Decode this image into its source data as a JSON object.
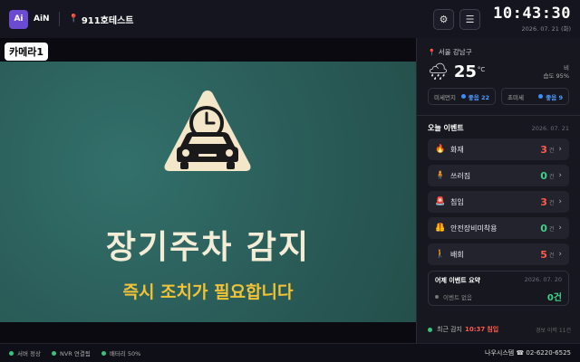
{
  "header": {
    "logo_text": "Ai",
    "brand": "AiN",
    "site": "911호테스트",
    "settings_icon": "gear-icon",
    "menu_icon": "menu-icon",
    "time": "10:43:30",
    "date": "2026. 07. 21 (화)"
  },
  "camera": {
    "label": "카메라1",
    "alert_title": "장기주차 감지",
    "alert_subtitle": "즉시 조치가 필요합니다",
    "colors": {
      "background": "#2c5f5b",
      "title": "#f3ecd6",
      "subtitle": "#f2c335",
      "sign": "#f3e6c9"
    }
  },
  "weather": {
    "location": "서울 강남구",
    "icon": "rain-cloud-icon",
    "temperature": "25",
    "unit": "°C",
    "condition": "비",
    "humidity": "습도 95%",
    "fine_dust_label": "미세먼지",
    "fine_dust_value": "좋음 22",
    "ultrafine_label": "초미세",
    "ultrafine_value": "좋음 9"
  },
  "events": {
    "title": "오늘 이벤트",
    "date": "2026. 07. 21",
    "unit": "건",
    "items": [
      {
        "name": "화재",
        "icon": "fire-icon",
        "glyph": "🔥",
        "count": "3",
        "color": "#ff5a4a"
      },
      {
        "name": "쓰러짐",
        "icon": "fall-person-icon",
        "glyph": "🧍",
        "count": "0",
        "color": "#3ed28a"
      },
      {
        "name": "침입",
        "icon": "alarm-icon",
        "glyph": "🚨",
        "count": "3",
        "color": "#ff5a4a"
      },
      {
        "name": "안전장비미착용",
        "icon": "safety-vest-icon",
        "glyph": "🦺",
        "count": "0",
        "color": "#3ed28a"
      },
      {
        "name": "배회",
        "icon": "walking-person-icon",
        "glyph": "🚶",
        "count": "5",
        "color": "#ff5a4a"
      }
    ]
  },
  "summary": {
    "title": "어제 이벤트 요약",
    "date": "2026. 07. 20",
    "text": "이벤트 없음",
    "value": "0건"
  },
  "recent": {
    "label": "최근 감지",
    "time": "10:37",
    "type": "침입",
    "right": "경보 이력 11건"
  },
  "footer": {
    "status_server": "서버 정상",
    "status_nvr": "NVR 연결됨",
    "status_battery": "배터리 50%",
    "company": "나우시스템 ☎ 02-6220-6525"
  }
}
